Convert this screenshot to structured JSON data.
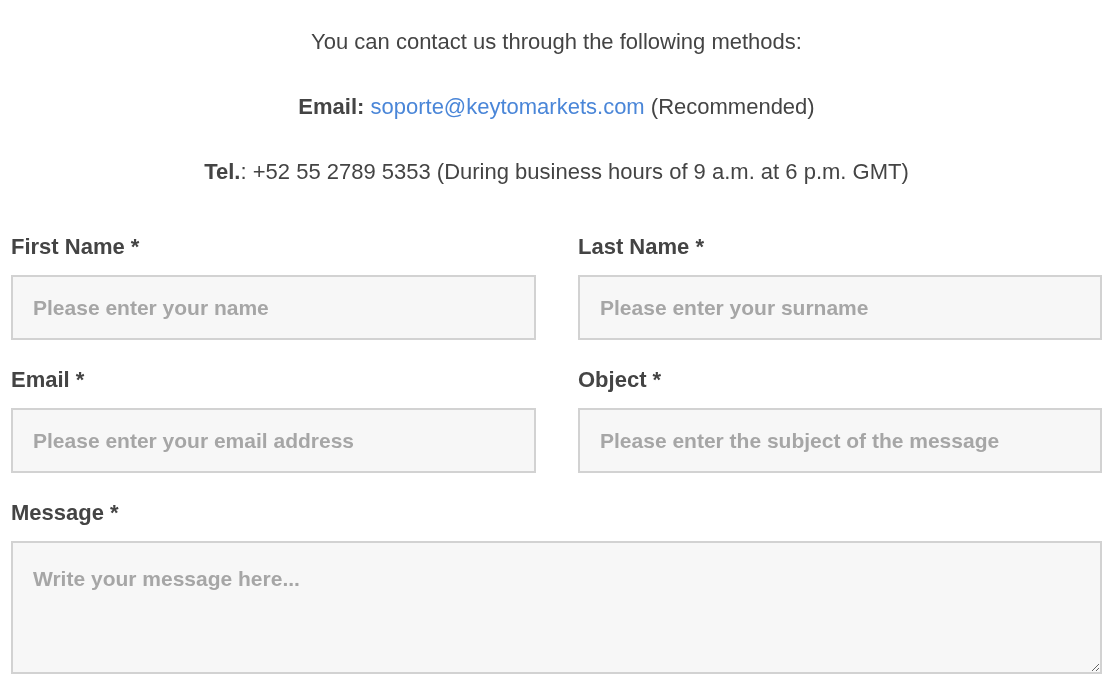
{
  "intro": "You can contact us through the following methods:",
  "email_line": {
    "label": "Email:",
    "address": "soporte@keytomarkets.com",
    "note": "(Recommended)"
  },
  "tel_line": "**Tel.**: +52 55 2789 5353 (During business hours of 9 a.m. at 6 p.m. GMT)",
  "fields": [
    {
      "label": "First Name *",
      "placeholder": "Please enter your name"
    },
    {
      "label": "Last Name *",
      "placeholder": "Please enter your surname"
    },
    {
      "label": "Email *",
      "placeholder": "Please enter your email address"
    },
    {
      "label": "Object *",
      "placeholder": "Please enter the subject of the message"
    }
  ],
  "message": {
    "label": "Message *",
    "placeholder": "Write your message here..."
  }
}
